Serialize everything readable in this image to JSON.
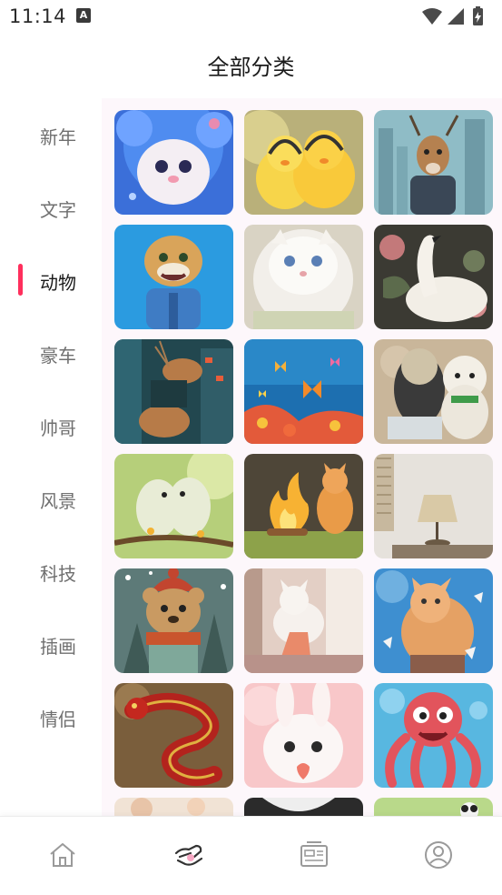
{
  "status_bar": {
    "time": "11:14"
  },
  "header": {
    "title": "全部分类"
  },
  "sidebar": {
    "items": [
      {
        "label": "新年",
        "active": false
      },
      {
        "label": "文字",
        "active": false
      },
      {
        "label": "动物",
        "active": true
      },
      {
        "label": "豪车",
        "active": false
      },
      {
        "label": "帅哥",
        "active": false
      },
      {
        "label": "风景",
        "active": false
      },
      {
        "label": "科技",
        "active": false
      },
      {
        "label": "插画",
        "active": false
      },
      {
        "label": "情侣",
        "active": false
      }
    ]
  },
  "grid": {
    "tiles": [
      {
        "subject": "blue-haired-kitten"
      },
      {
        "subject": "yellow-chicks-headphones"
      },
      {
        "subject": "deer-in-city"
      },
      {
        "subject": "cartoon-cheetah"
      },
      {
        "subject": "white-fluffy-cat"
      },
      {
        "subject": "white-swan"
      },
      {
        "subject": "deer-neon-city"
      },
      {
        "subject": "butterflies-flowers"
      },
      {
        "subject": "teddy-bears"
      },
      {
        "subject": "lovebirds-branch"
      },
      {
        "subject": "cat-campfire"
      },
      {
        "subject": "table-lamp"
      },
      {
        "subject": "bear-scarf"
      },
      {
        "subject": "cat-window"
      },
      {
        "subject": "cat-leaves"
      },
      {
        "subject": "red-dragon"
      },
      {
        "subject": "white-bunny-heart"
      },
      {
        "subject": "red-octopus"
      },
      {
        "subject": "partial-floral"
      },
      {
        "subject": "partial-swan"
      },
      {
        "subject": "partial-panda"
      }
    ]
  },
  "bottom_nav": {
    "items": [
      {
        "icon": "home-icon",
        "active": false
      },
      {
        "icon": "category-icon",
        "active": true
      },
      {
        "icon": "wallpaper-icon",
        "active": false
      },
      {
        "icon": "profile-icon",
        "active": false
      }
    ]
  },
  "colors": {
    "accent": "#ff2f5c",
    "nav_active_dot": "#f7a8c4",
    "grid_bg": "#fdf7fb"
  }
}
